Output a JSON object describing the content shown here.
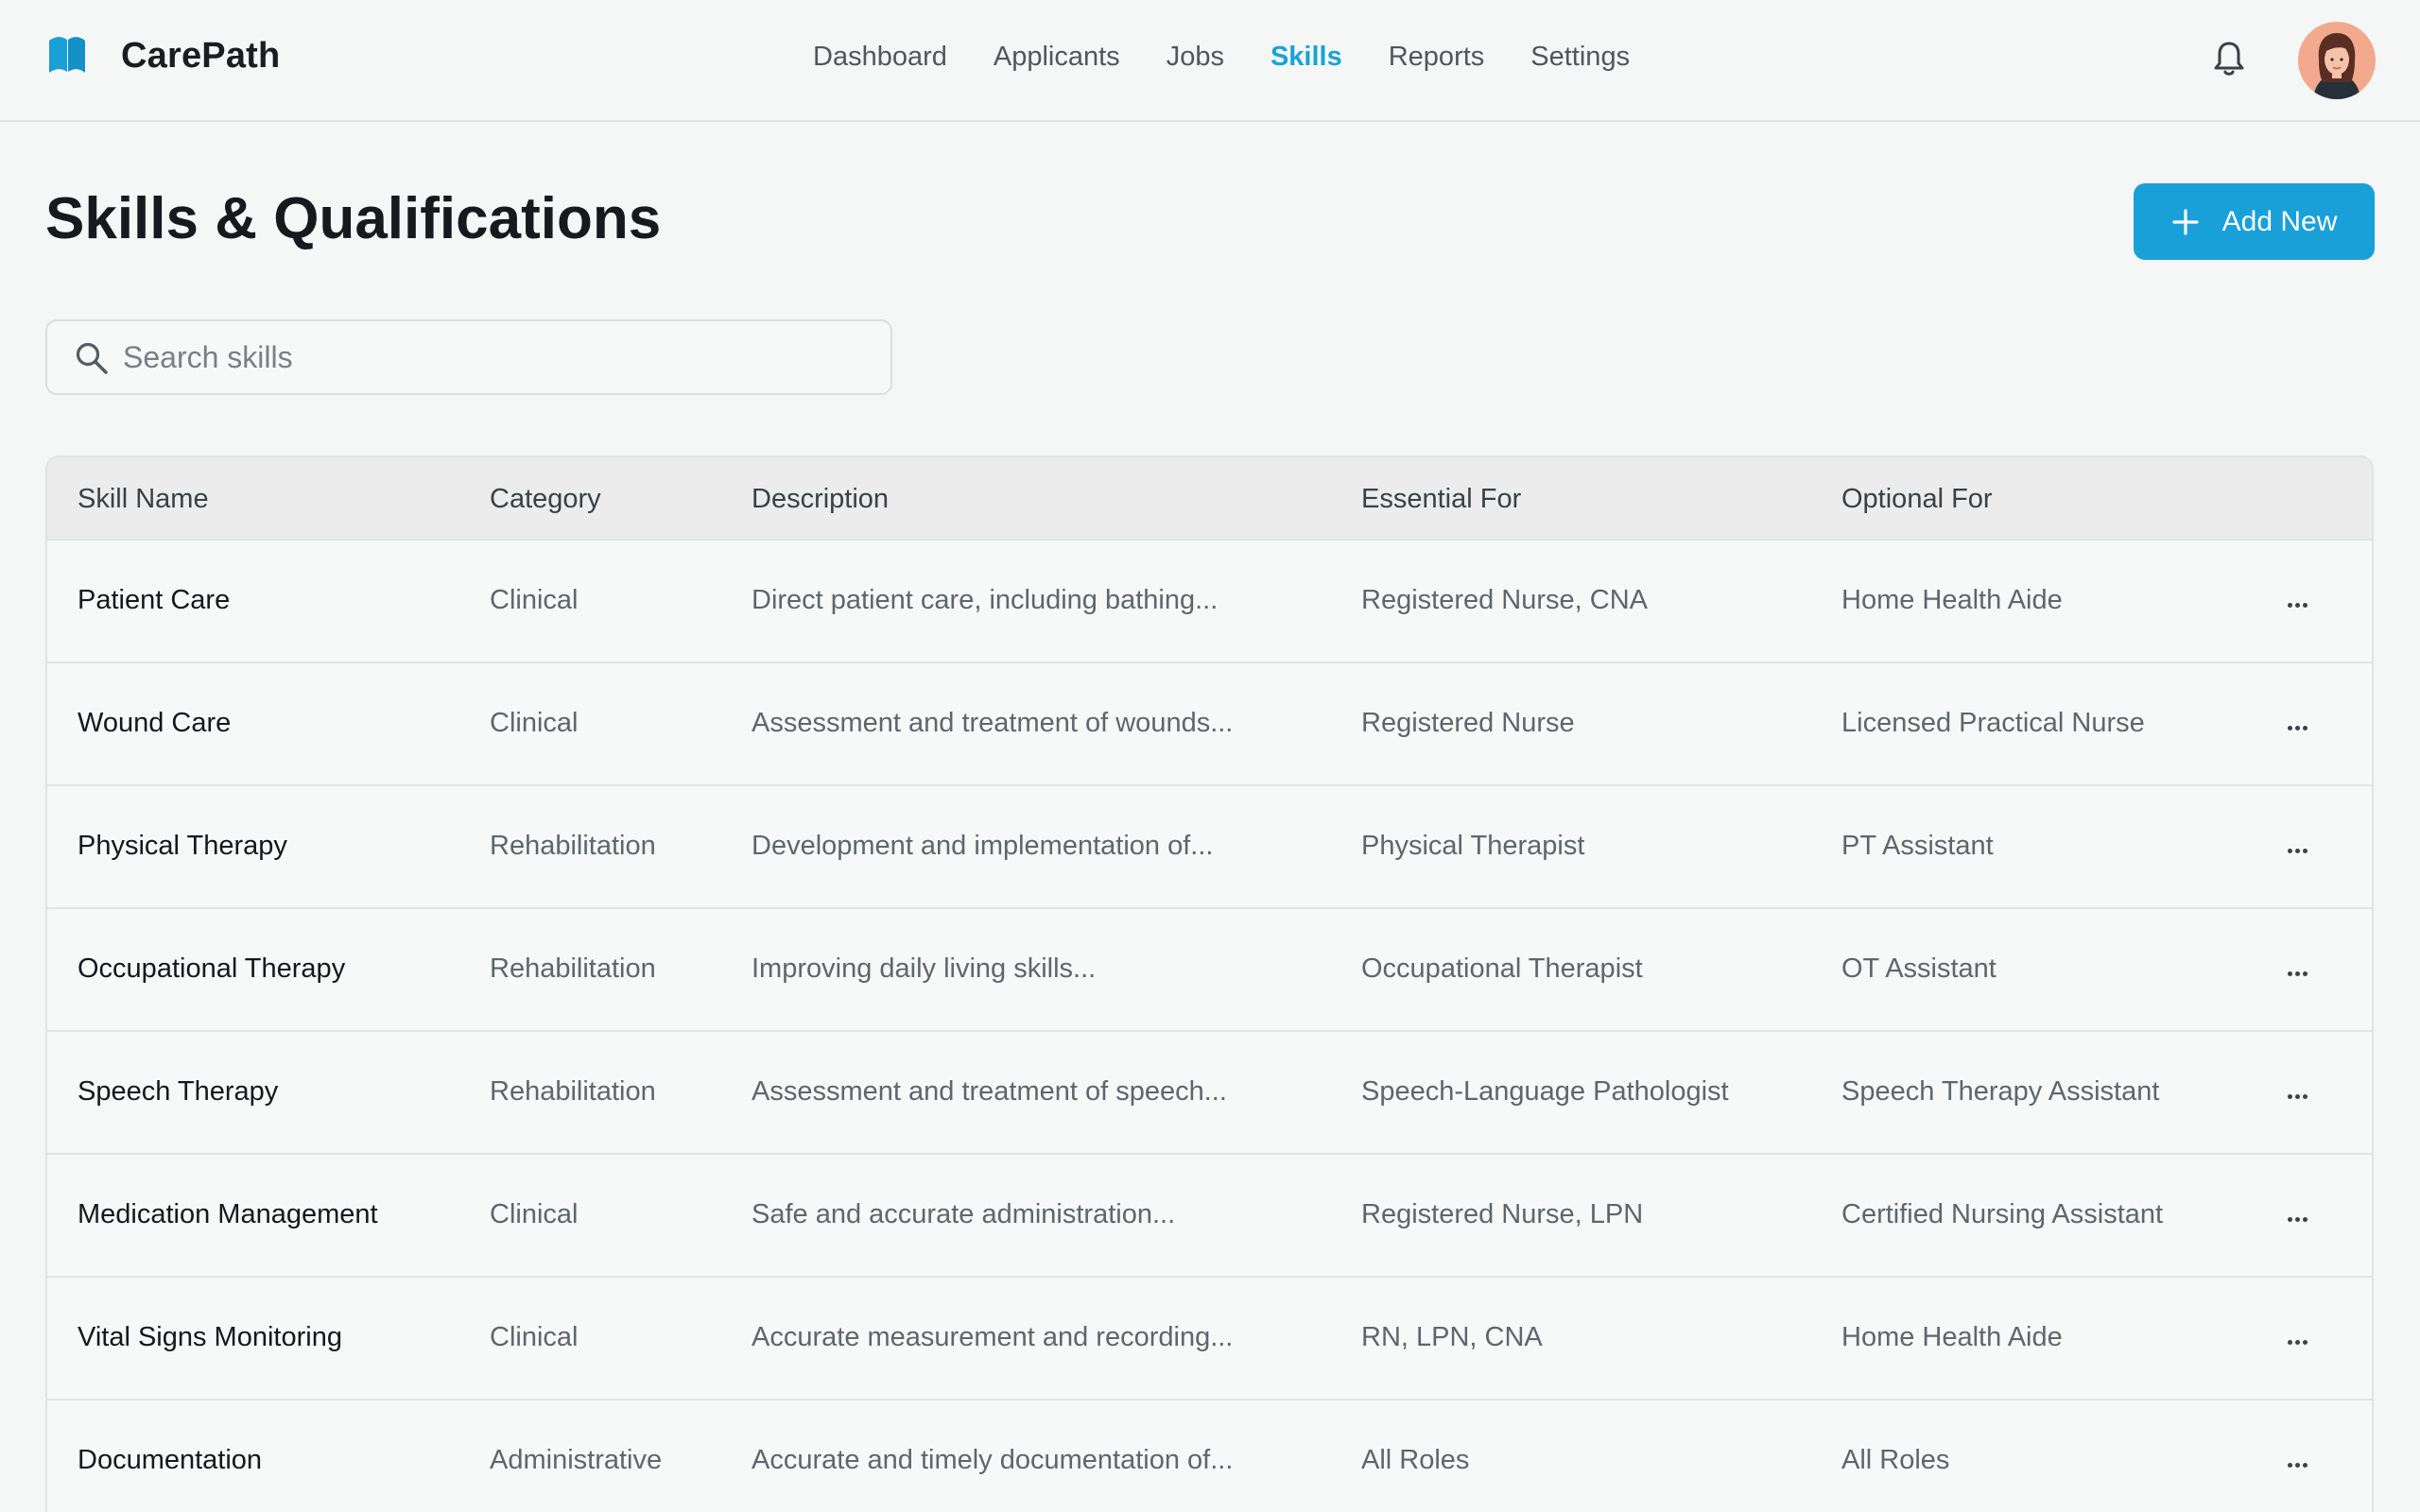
{
  "app": {
    "brand_name": "CarePath",
    "accent_color": "#1aa3d6"
  },
  "nav": {
    "items": [
      {
        "label": "Dashboard",
        "active": false
      },
      {
        "label": "Applicants",
        "active": false
      },
      {
        "label": "Jobs",
        "active": false
      },
      {
        "label": "Skills",
        "active": true
      },
      {
        "label": "Reports",
        "active": false
      },
      {
        "label": "Settings",
        "active": false
      }
    ],
    "bell_icon": "bell-icon",
    "avatar_icon": "user-avatar"
  },
  "header": {
    "title": "Skills & Qualifications",
    "add_button_label": "Add New",
    "add_icon": "plus-icon"
  },
  "search": {
    "placeholder": "Search skills",
    "value": "",
    "icon": "search-icon"
  },
  "table": {
    "columns": [
      "Skill Name",
      "Category",
      "Description",
      "Essential For",
      "Optional For"
    ],
    "rows": [
      {
        "name": "Patient Care",
        "category": "Clinical",
        "description": "Direct patient care, including bathing...",
        "essential": "Registered Nurse, CNA",
        "optional": "Home Health Aide"
      },
      {
        "name": "Wound Care",
        "category": "Clinical",
        "description": "Assessment and treatment of wounds...",
        "essential": "Registered Nurse",
        "optional": "Licensed Practical Nurse"
      },
      {
        "name": "Physical Therapy",
        "category": "Rehabilitation",
        "description": "Development and implementation of...",
        "essential": "Physical Therapist",
        "optional": "PT Assistant"
      },
      {
        "name": "Occupational Therapy",
        "category": "Rehabilitation",
        "description": "Improving daily living skills...",
        "essential": "Occupational Therapist",
        "optional": "OT Assistant"
      },
      {
        "name": "Speech Therapy",
        "category": "Rehabilitation",
        "description": "Assessment and treatment of speech...",
        "essential": "Speech-Language Pathologist",
        "optional": "Speech Therapy Assistant"
      },
      {
        "name": "Medication Management",
        "category": "Clinical",
        "description": "Safe and accurate administration...",
        "essential": "Registered Nurse, LPN",
        "optional": "Certified Nursing Assistant"
      },
      {
        "name": "Vital Signs Monitoring",
        "category": "Clinical",
        "description": "Accurate measurement and recording...",
        "essential": "RN, LPN, CNA",
        "optional": "Home Health Aide"
      },
      {
        "name": "Documentation",
        "category": "Administrative",
        "description": "Accurate and timely documentation of...",
        "essential": "All Roles",
        "optional": "All Roles"
      }
    ],
    "row_action_icon": "more-horizontal-icon"
  }
}
